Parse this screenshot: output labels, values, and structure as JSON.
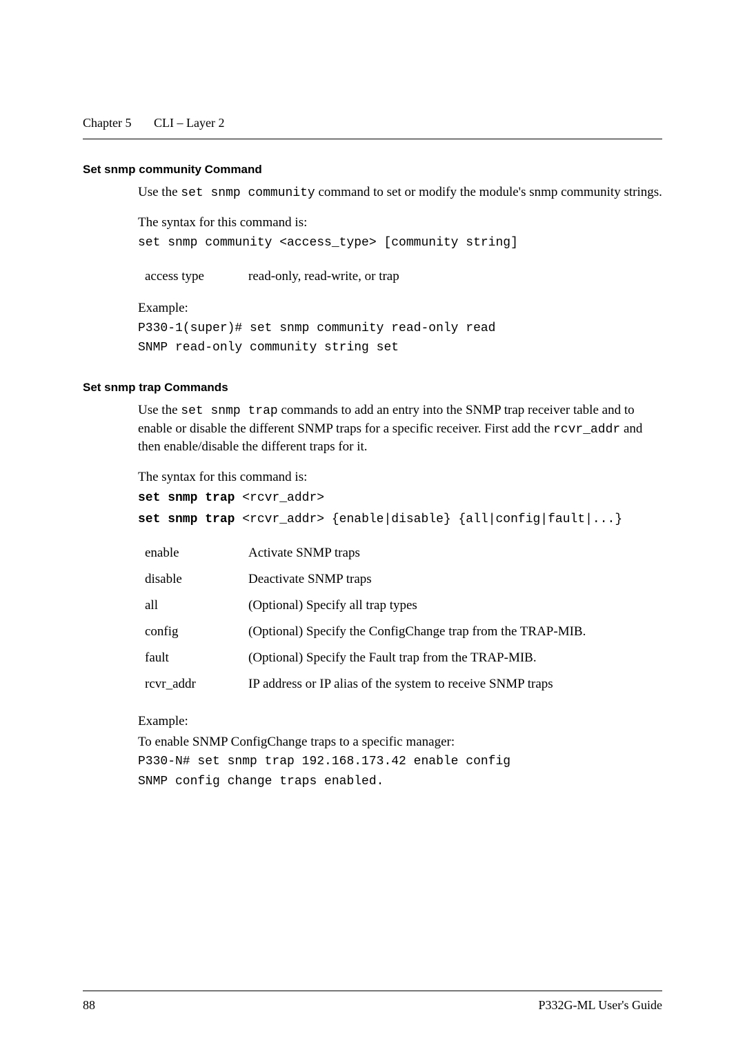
{
  "header": {
    "chapter": "Chapter 5",
    "title": "CLI – Layer 2"
  },
  "s1": {
    "title": "Set snmp community Command",
    "p1a": "Use the ",
    "p1b": "set snmp community",
    "p1c": " command to set or modify the module's snmp community strings.",
    "p2": "The syntax for this command is:",
    "code1": "set snmp community <access_type> [community string]",
    "param_key": "access type",
    "param_val": "read-only, read-write, or trap",
    "ex_label": "Example:",
    "ex_l1": "P330-1(super)# set snmp community read-only read",
    "ex_l2": "SNMP read-only community string set"
  },
  "s2": {
    "title": "Set snmp trap Commands",
    "p1a": "Use the ",
    "p1b": "set snmp trap",
    "p1c": " commands to add an entry into the SNMP trap receiver table and to enable or disable the different SNMP traps for a specific receiver. First add the ",
    "p1d": "rcvr_addr",
    "p1e": " and then enable/disable the different traps for it.",
    "p2": "The syntax for this command is:",
    "c1a": "set snmp trap ",
    "c1b": "<rcvr_addr>",
    "c2a": "set snmp trap ",
    "c2b": "<rcvr_addr> {enable|disable} {all|config|fault|...}",
    "tbl": {
      "r1k": "enable",
      "r1v": "Activate SNMP traps",
      "r2k": "disable",
      "r2v": "Deactivate SNMP traps",
      "r3k": "all",
      "r3v": "(Optional) Specify all trap types",
      "r4k": "config",
      "r4v": "(Optional) Specify the ConfigChange trap from the TRAP-MIB.",
      "r5k": "fault",
      "r5v": "(Optional) Specify the Fault trap from the TRAP-MIB.",
      "r6k": "rcvr_addr",
      "r6v": "IP address or IP alias of the system to receive SNMP traps"
    },
    "ex_label": "Example:",
    "ex_intro": "To enable SNMP ConfigChange traps to a specific manager:",
    "ex_l1": "P330-N# set snmp trap 192.168.173.42 enable config",
    "ex_l2": "SNMP config change traps enabled."
  },
  "footer": {
    "pagenum": "88",
    "guide": "P332G-ML User's Guide"
  }
}
